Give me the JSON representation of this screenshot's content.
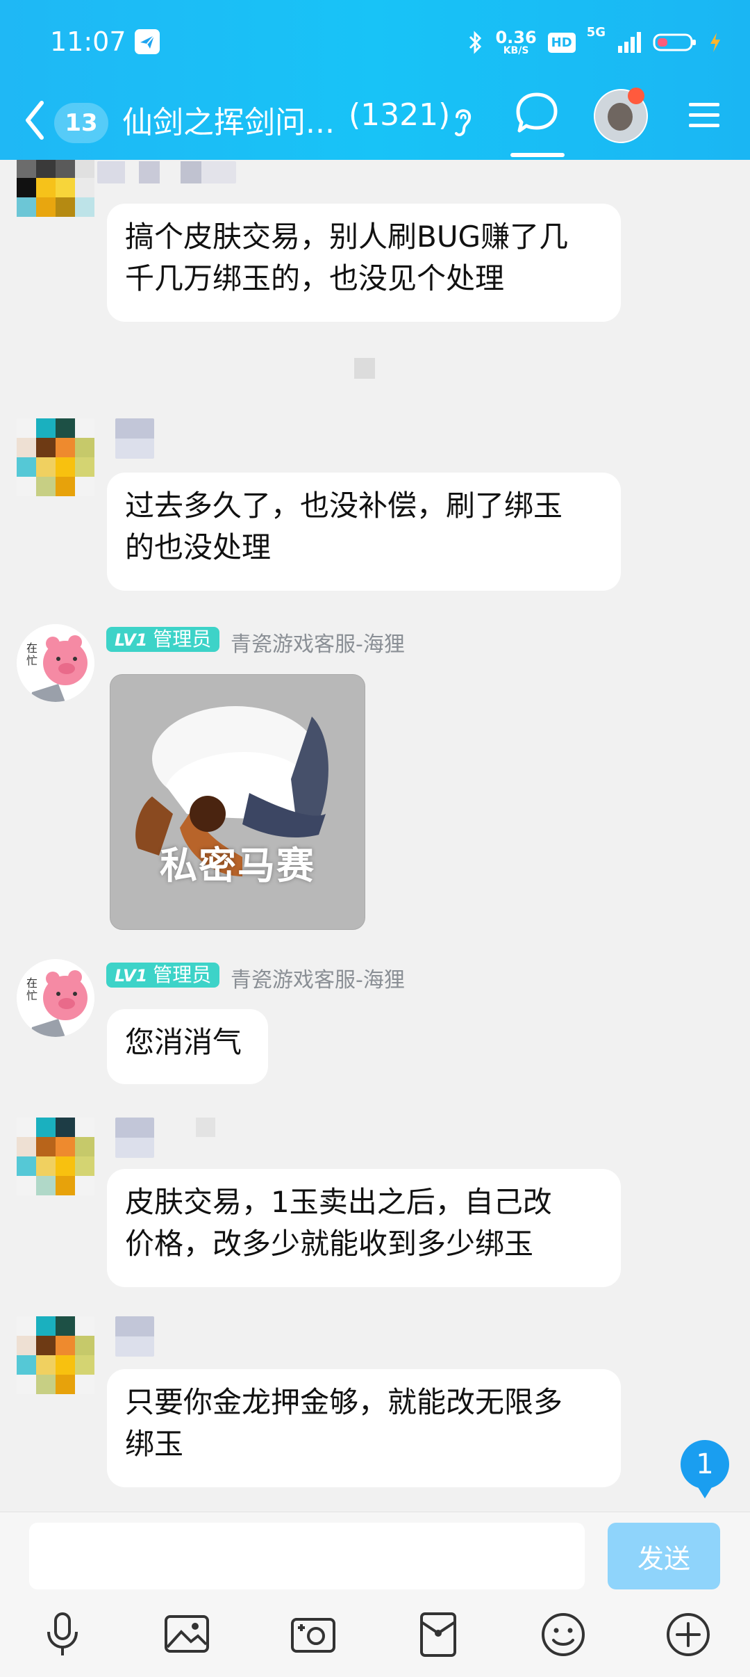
{
  "status_bar": {
    "time": "11:07",
    "net_speed_value": "0.36",
    "net_speed_unit": "KB/S",
    "hd_label": "HD",
    "network_label": "5G"
  },
  "nav": {
    "unread_count": "13",
    "group_title": "仙剑之挥剑问...",
    "member_count": "(1321)"
  },
  "messages": [
    {
      "type": "text",
      "text_line1": "搞个皮肤交易，别人刷BUG赚了几",
      "text_line2": "千几万绑玉的，也没见个处理"
    },
    {
      "type": "text",
      "text_line1": "过去多久了，也没补偿，刷了绑玉",
      "text_line2": "的也没处理"
    },
    {
      "type": "sticker",
      "role_level": "LV1",
      "role_label": "管理员",
      "sender": "青瓷游戏客服-海狸",
      "sticker_caption": "私密马赛"
    },
    {
      "type": "text",
      "role_level": "LV1",
      "role_label": "管理员",
      "sender": "青瓷游戏客服-海狸",
      "text_line1": "您消消气"
    },
    {
      "type": "text",
      "text_line1": "皮肤交易，1玉卖出之后，自己改",
      "text_line2": "价格，改多少就能收到多少绑玉"
    },
    {
      "type": "text",
      "text_line1": "只要你金龙押金够，就能改无限多",
      "text_line2": "绑玉"
    }
  ],
  "new_message_badge": "1",
  "input": {
    "placeholder": "",
    "send_label": "发送"
  },
  "toolbar": [
    "mic-icon",
    "image-icon",
    "camera-icon",
    "red-packet-icon",
    "emoji-icon",
    "plus-icon"
  ],
  "colors": {
    "header": "#1ab6f3",
    "admin_badge": "#3dd3c8",
    "send_button": "#8fd4fb",
    "badge": "#1a9ef0"
  }
}
